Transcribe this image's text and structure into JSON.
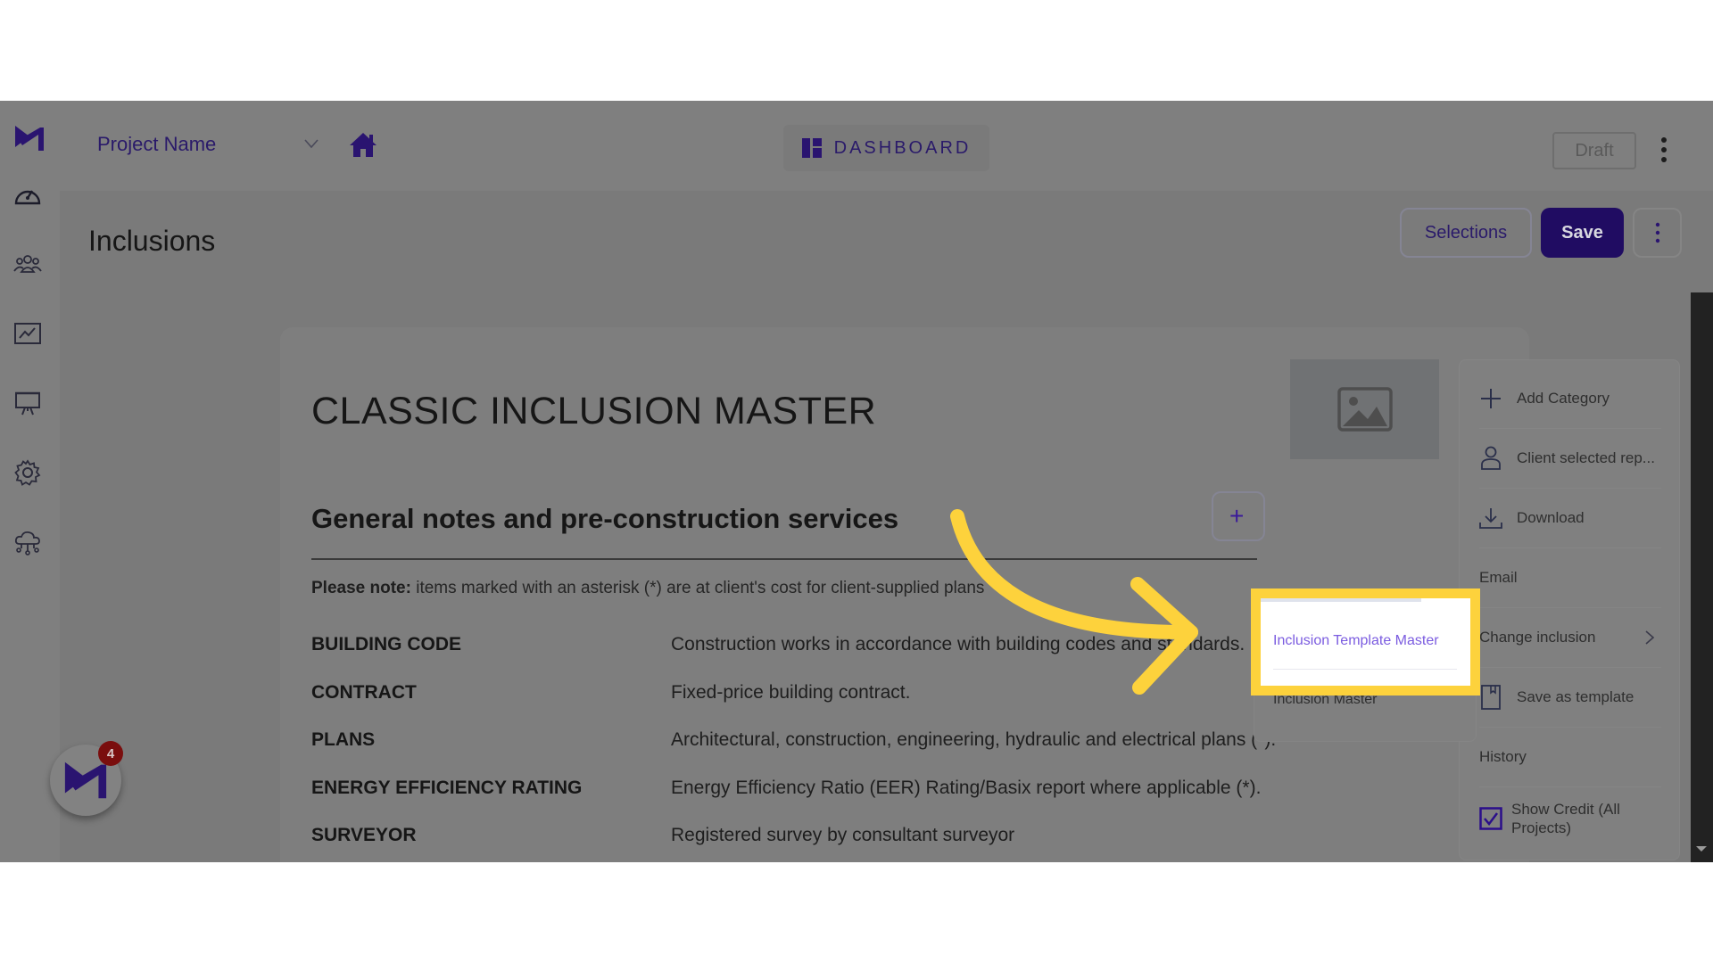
{
  "header": {
    "project_name": "Project Name",
    "dashboard_label": "DASHBOARD",
    "status_button": "Draft"
  },
  "sidebar": {
    "items": [
      {
        "icon": "speedometer-icon"
      },
      {
        "icon": "users-icon"
      },
      {
        "icon": "chart-icon"
      },
      {
        "icon": "presentation-icon"
      },
      {
        "icon": "gear-icon"
      },
      {
        "icon": "cloud-network-icon"
      }
    ]
  },
  "page": {
    "title": "Inclusions",
    "selections_label": "Selections",
    "save_label": "Save"
  },
  "document": {
    "title": "CLASSIC INCLUSION MASTER",
    "section_title": "General notes and pre-construction services",
    "add_button": "+",
    "note_bold": "Please note:",
    "note_text": " items marked with an asterisk (*) are at client's cost for client-supplied plans",
    "rows": [
      {
        "key": "BUILDING CODE",
        "value": "Construction works in accordance with building codes and standards."
      },
      {
        "key": "CONTRACT",
        "value": "Fixed-price building contract."
      },
      {
        "key": "PLANS",
        "value": "Architectural, construction, engineering, hydraulic and electrical plans (*)."
      },
      {
        "key": "ENERGY EFFICIENCY RATING",
        "value": "Energy Efficiency Ratio (EER) Rating/Basix report where applicable (*)."
      },
      {
        "key": "SURVEYOR",
        "value": "Registered survey by consultant surveyor"
      }
    ]
  },
  "menu": {
    "items": [
      {
        "label": "Add Category",
        "icon": "plus-icon"
      },
      {
        "label": "Client selected rep...",
        "icon": "user-icon"
      },
      {
        "label": "Download",
        "icon": "download-icon"
      },
      {
        "label": "Email"
      },
      {
        "label": "Change inclusion",
        "icon": "chevron-right-icon"
      },
      {
        "label": "Save as template",
        "icon": "bookmark-icon"
      },
      {
        "label": "History"
      },
      {
        "label": "Show Credit (All Projects)",
        "checked": true
      }
    ]
  },
  "submenu": {
    "options": [
      "Inclusion Template Master",
      "Inclusion Master"
    ]
  },
  "notifications": {
    "count": "4"
  },
  "colors": {
    "brand": "#200c62",
    "highlight": "#fdd23c",
    "submenu_selected_text": "#7b5ce0"
  }
}
